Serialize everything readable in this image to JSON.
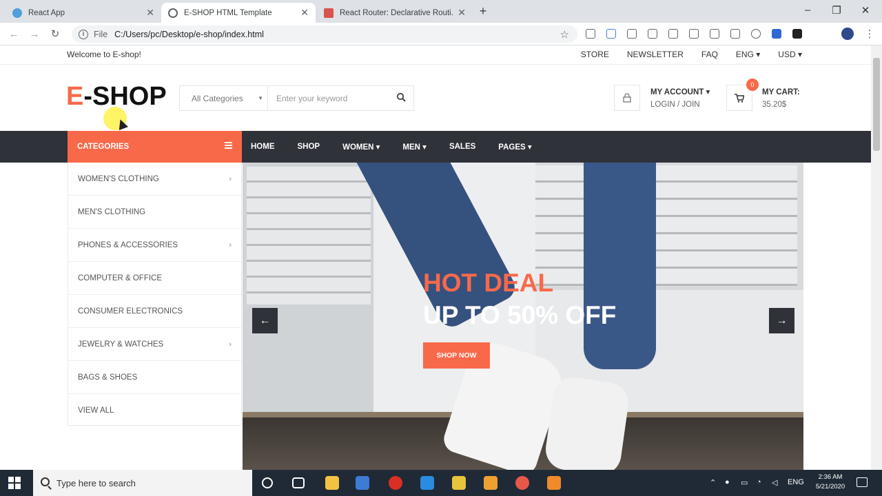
{
  "browser": {
    "tabs": [
      {
        "title": "React App",
        "favicon_color": "#4f9fd9",
        "active": false
      },
      {
        "title": "E-SHOP HTML Template",
        "favicon_color": "#5f6368",
        "active": true
      },
      {
        "title": "React Router: Declarative Routi...",
        "favicon_color": "#d9534f",
        "active": false
      }
    ],
    "new_tab": "+",
    "address_scheme": "File",
    "address_url": "C:/Users/pc/Desktop/e-shop/index.html"
  },
  "site": {
    "welcome": "Welcome to E-shop!",
    "top_links": [
      "STORE",
      "NEWSLETTER",
      "FAQ",
      "ENG ▾",
      "USD ▾"
    ],
    "logo_first": "E",
    "logo_rest": "-SHOP",
    "search": {
      "category": "All Categories",
      "placeholder": "Enter your keyword"
    },
    "account": {
      "title": "MY ACCOUNT ▾",
      "subtitle": "LOGIN / JOIN"
    },
    "cart": {
      "title": "MY CART:",
      "amount": "35.20$",
      "count": "0"
    },
    "categories_label": "CATEGORIES",
    "menu": [
      "HOME",
      "SHOP",
      "WOMEN ▾",
      "MEN ▾",
      "SALES",
      "PAGES ▾"
    ],
    "category_list": [
      {
        "label": "WOMEN'S CLOTHING",
        "has_sub": true
      },
      {
        "label": "MEN'S CLOTHING",
        "has_sub": false
      },
      {
        "label": "PHONES & ACCESSORIES",
        "has_sub": true
      },
      {
        "label": "COMPUTER & OFFICE",
        "has_sub": false
      },
      {
        "label": "CONSUMER ELECTRONICS",
        "has_sub": false
      },
      {
        "label": "JEWELRY & WATCHES",
        "has_sub": true
      },
      {
        "label": "BAGS & SHOES",
        "has_sub": false
      },
      {
        "label": "VIEW ALL",
        "has_sub": false
      }
    ],
    "hero": {
      "line1": "HOT DEAL",
      "line2": "UP TO 50% OFF",
      "button": "SHOP NOW",
      "prev": "←",
      "next": "→"
    },
    "colors": {
      "accent": "#f8694a",
      "dark": "#30323a"
    }
  },
  "taskbar": {
    "search_placeholder": "Type here to search",
    "language": "ENG",
    "time": "2:36 AM",
    "date": "5/21/2020"
  }
}
